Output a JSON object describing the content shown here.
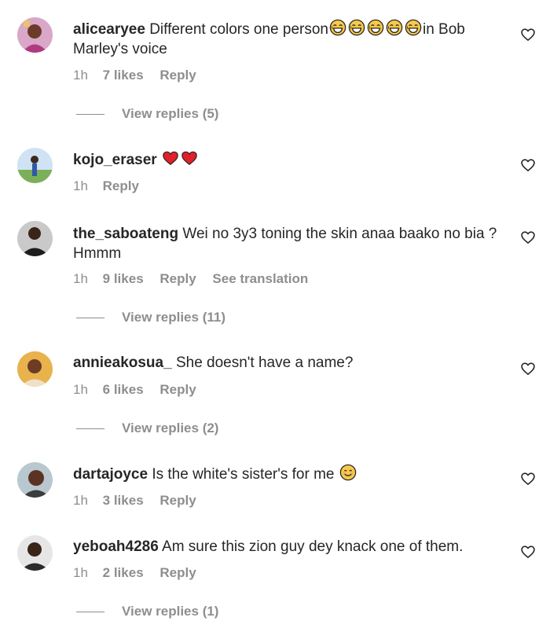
{
  "colors": {
    "username": "#262626",
    "meta": "#8e8e8e",
    "heart_red": "#ed4956"
  },
  "comments": [
    {
      "username": "alicearyee",
      "text_before": "Different colors one person",
      "emoji": "laughing-emoji x5",
      "text_after": "in Bob Marley's voice",
      "time": "1h",
      "likes": "7 likes",
      "reply": "Reply",
      "translate": "",
      "view_replies": "View replies (5)"
    },
    {
      "username": "kojo_eraser",
      "emoji": "red-heart-emoji x2",
      "time": "1h",
      "reply": "Reply"
    },
    {
      "username": "the_saboateng",
      "text": "Wei no 3y3 toning the skin anaa baako no bia ? Hmmm",
      "time": "1h",
      "likes": "9 likes",
      "reply": "Reply",
      "translate": "See translation",
      "view_replies": "View replies (11)"
    },
    {
      "username": "annieakosua_",
      "text": "She doesn't have a name?",
      "time": "1h",
      "likes": "6 likes",
      "reply": "Reply",
      "view_replies": "View replies (2)"
    },
    {
      "username": "dartajoyce",
      "text": "Is the white's sister's for me",
      "emoji": "smiling-emoji",
      "time": "1h",
      "likes": "3 likes",
      "reply": "Reply"
    },
    {
      "username": "yeboah4286",
      "text": "Am sure this zion guy dey knack one of them.",
      "time": "1h",
      "likes": "2 likes",
      "reply": "Reply",
      "view_replies": "View replies (1)"
    }
  ]
}
